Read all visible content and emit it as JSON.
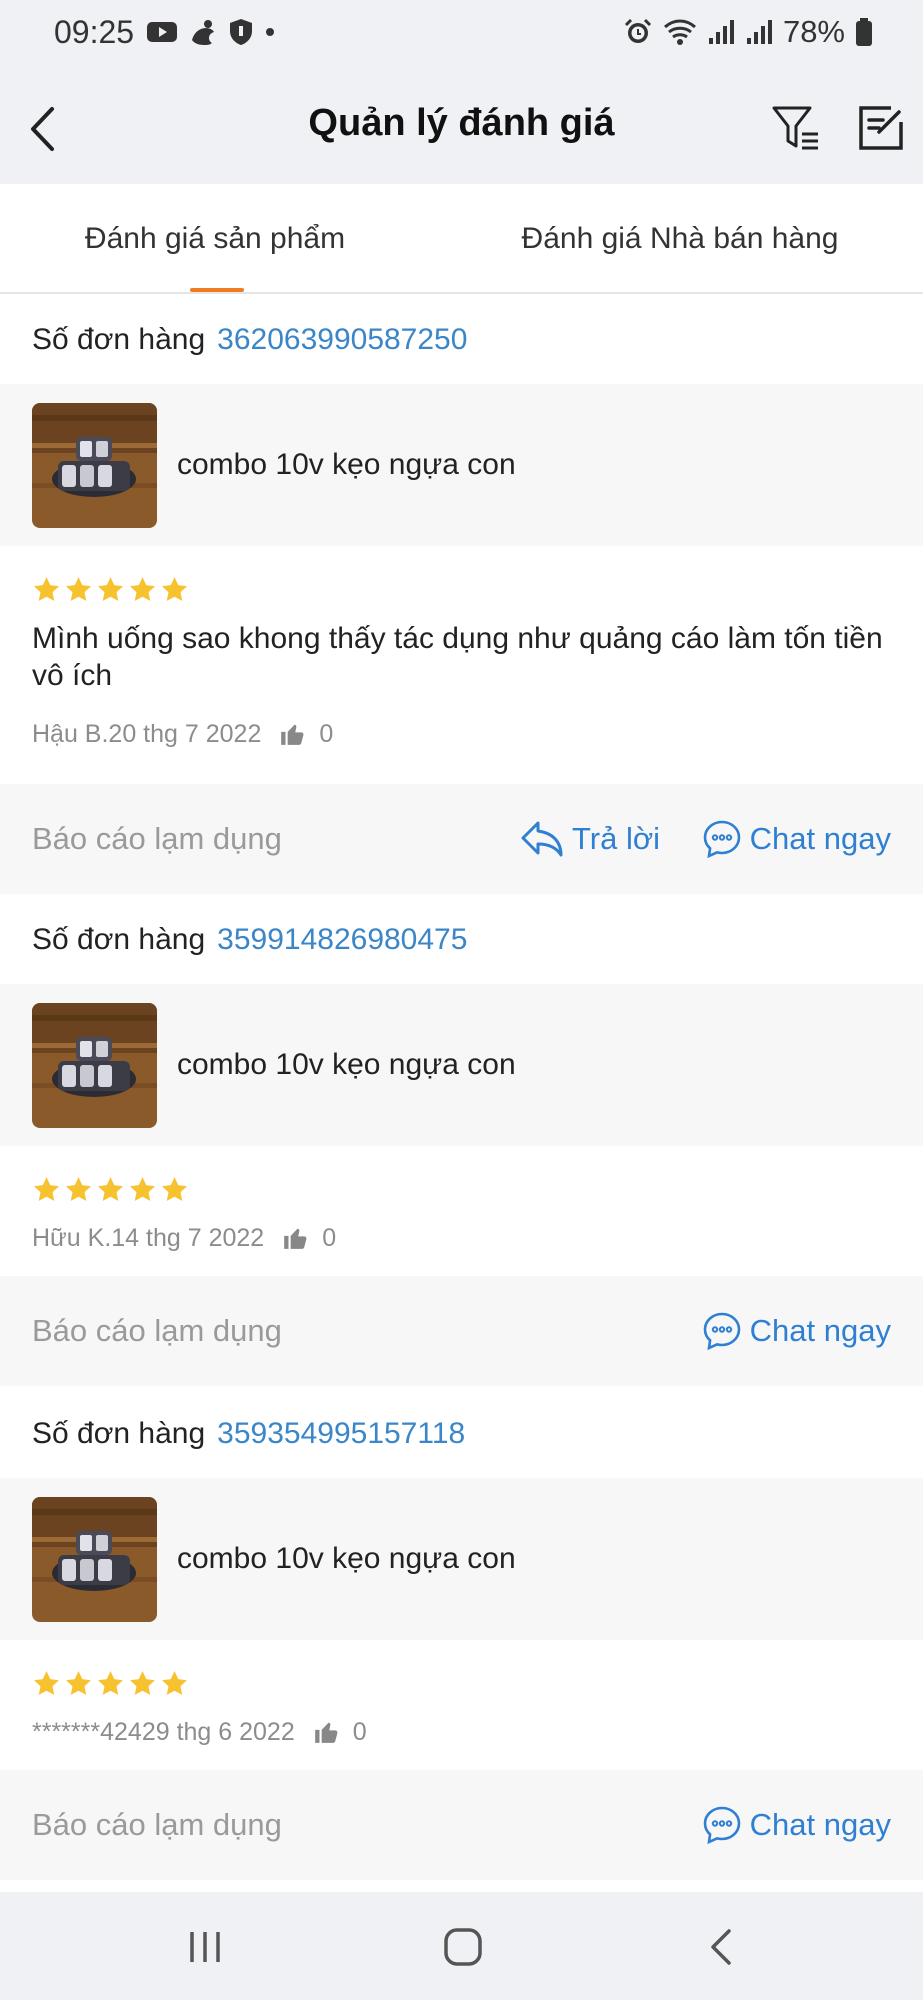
{
  "status_bar": {
    "time": "09:25",
    "battery": "78%",
    "left_icons": [
      "youtube-icon",
      "app-icon",
      "shield-icon",
      "dot-icon"
    ],
    "right_icons": [
      "alarm-icon",
      "wifi-icon",
      "signal-icon",
      "signal-icon",
      "battery-icon"
    ]
  },
  "header": {
    "title": "Quản lý đánh giá",
    "back_icon": "chevron-left-icon",
    "filter_icon": "filter-icon",
    "edit_icon": "edit-icon"
  },
  "tabs": [
    {
      "label": "Đánh giá sản phẩm",
      "active": true
    },
    {
      "label": "Đánh giá Nhà bán hàng",
      "active": false
    }
  ],
  "accent_color": "#f07c22",
  "link_color": "#2f7fd2",
  "star_color": "#f7c230",
  "reviews": [
    {
      "order_label": "Số đơn hàng",
      "order_number": "362063990587250",
      "product_name": "combo 10v kẹo ngựa con",
      "rating": 5,
      "text": "Mình uống sao khong thấy tác dụng như quảng cáo làm tốn tiền vô ích",
      "meta": "Hậu B.20 thg 7 2022",
      "likes": "0",
      "report_label": "Báo cáo lạm dụng",
      "reply_label": "Trả lời",
      "chat_label": "Chat ngay"
    },
    {
      "order_label": "Số đơn hàng",
      "order_number": "359914826980475",
      "product_name": "combo 10v kẹo ngựa con",
      "rating": 5,
      "text": "",
      "meta": "Hữu K.14 thg 7 2022",
      "likes": "0",
      "report_label": "Báo cáo lạm dụng",
      "chat_label": "Chat ngay"
    },
    {
      "order_label": "Số đơn hàng",
      "order_number": "359354995157118",
      "product_name": "combo 10v kẹo ngựa con",
      "rating": 5,
      "text": "",
      "meta": "*******42429 thg 6 2022",
      "likes": "0",
      "report_label": "Báo cáo lạm dụng",
      "chat_label": "Chat ngay"
    }
  ],
  "nav_bar": [
    "recent-apps-icon",
    "home-icon",
    "back-icon"
  ]
}
